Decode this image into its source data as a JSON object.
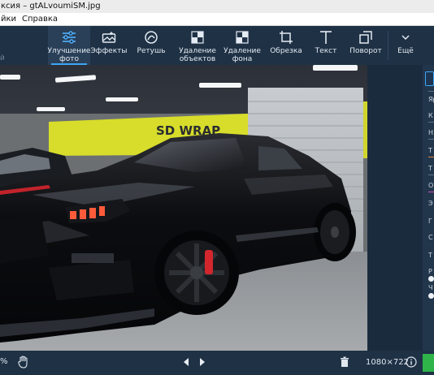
{
  "window": {
    "title": "ксия – gtALvoumiSM.jpg"
  },
  "menu": {
    "items": [
      "йки",
      "Справка"
    ]
  },
  "toolbar": {
    "left_text": "й",
    "tools": [
      {
        "label": "Улучшение\nфото",
        "icon": "sliders-icon",
        "active": true
      },
      {
        "label": "Эффекты",
        "icon": "effects-icon",
        "active": false
      },
      {
        "label": "Ретушь",
        "icon": "retouch-icon",
        "active": false
      },
      {
        "label": "Удаление\nобъектов",
        "icon": "remove-objects-icon",
        "active": false
      },
      {
        "label": "Удаление\nфона",
        "icon": "remove-background-icon",
        "active": false
      },
      {
        "label": "Обрезка",
        "icon": "crop-icon",
        "active": false
      },
      {
        "label": "Текст",
        "icon": "text-icon",
        "active": false
      },
      {
        "label": "Поворот",
        "icon": "rotate-icon",
        "active": false
      },
      {
        "label": "Ещё",
        "icon": "chevron-down-icon",
        "active": false
      }
    ]
  },
  "photo": {
    "sign_text": "SD WRAP"
  },
  "right_panel": {
    "labels": [
      "Яр",
      "К",
      "Н",
      "Т",
      "Т",
      "О",
      "Э",
      "Г",
      "С",
      "Т",
      "Р",
      "Ч"
    ]
  },
  "bottom": {
    "zoom": "%",
    "image_size": "1080×722"
  },
  "colors": {
    "accent": "#3ca5f5",
    "toolbar": "#1f3145",
    "background": "#1b2b3e"
  }
}
